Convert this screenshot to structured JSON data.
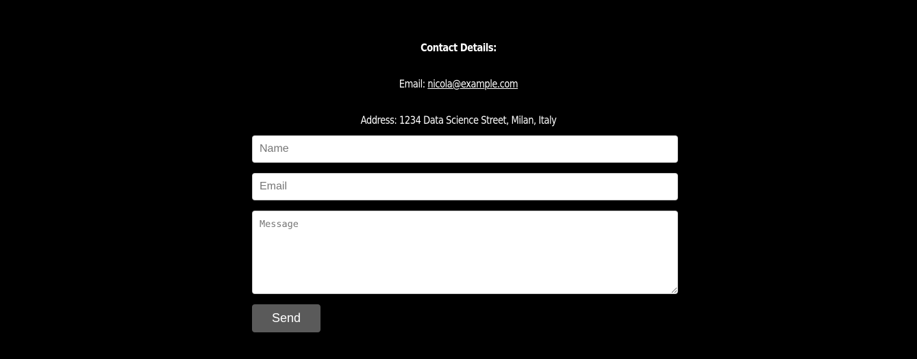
{
  "contact": {
    "title": "Contact Details:",
    "email_label": "Email:",
    "email_value": "nicola@example.com",
    "address_label": "Address:",
    "address_value": "1234 Data Science Street, Milan, Italy"
  },
  "form": {
    "name_placeholder": "Name",
    "name_value": "",
    "email_placeholder": "Email",
    "email_value": "",
    "message_placeholder": "Message",
    "message_value": "",
    "send_label": "Send"
  },
  "colors": {
    "background": "#000000",
    "text": "#ffffff",
    "button": "#5a5a5a"
  }
}
